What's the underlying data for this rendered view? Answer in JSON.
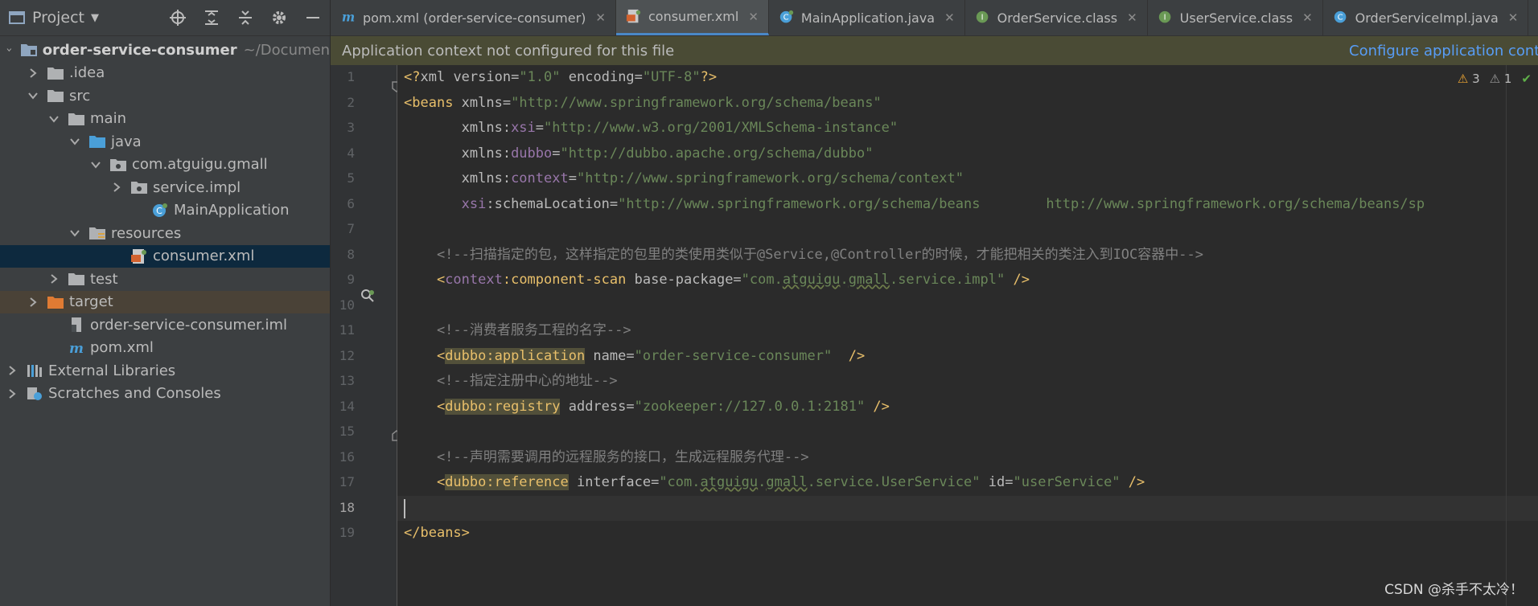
{
  "sidebar": {
    "title": "Project",
    "tree": [
      {
        "label": "order-service-consumer",
        "suffix": "~/Documen",
        "bold": true,
        "expanded": true,
        "depth": 0,
        "icon": "module-folder-icon"
      },
      {
        "label": ".idea",
        "expanded": false,
        "depth": 1,
        "icon": "folder-icon"
      },
      {
        "label": "src",
        "expanded": true,
        "depth": 1,
        "icon": "folder-icon"
      },
      {
        "label": "main",
        "expanded": true,
        "depth": 2,
        "icon": "folder-icon"
      },
      {
        "label": "java",
        "expanded": true,
        "depth": 3,
        "icon": "source-folder-icon"
      },
      {
        "label": "com.atguigu.gmall",
        "expanded": true,
        "depth": 4,
        "icon": "package-icon"
      },
      {
        "label": "service.impl",
        "expanded": false,
        "depth": 5,
        "icon": "package-icon"
      },
      {
        "label": "MainApplication",
        "depth": 6,
        "icon": "spring-class-icon"
      },
      {
        "label": "resources",
        "expanded": true,
        "depth": 3,
        "icon": "resources-folder-icon"
      },
      {
        "label": "consumer.xml",
        "depth": 5,
        "icon": "spring-xml-icon",
        "selected": true
      },
      {
        "label": "test",
        "expanded": false,
        "depth": 2,
        "icon": "folder-icon"
      },
      {
        "label": "target",
        "expanded": false,
        "depth": 1,
        "icon": "excluded-folder-icon",
        "excluded": true
      },
      {
        "label": "order-service-consumer.iml",
        "depth": 2,
        "icon": "iml-file-icon"
      },
      {
        "label": "pom.xml",
        "depth": 2,
        "icon": "maven-icon"
      },
      {
        "label": "External Libraries",
        "expanded": false,
        "depth": 0,
        "icon": "libraries-icon"
      },
      {
        "label": "Scratches and Consoles",
        "expanded": false,
        "depth": 0,
        "icon": "scratches-icon"
      }
    ]
  },
  "tabs": [
    {
      "label": "pom.xml (order-service-consumer)",
      "icon": "maven-icon",
      "active": false
    },
    {
      "label": "consumer.xml",
      "icon": "spring-xml-icon",
      "active": true
    },
    {
      "label": "MainApplication.java",
      "icon": "spring-class-icon",
      "active": false
    },
    {
      "label": "OrderService.class",
      "icon": "interface-icon",
      "active": false
    },
    {
      "label": "UserService.class",
      "icon": "interface-icon",
      "active": false
    },
    {
      "label": "OrderServiceImpl.java",
      "icon": "class-icon",
      "active": false
    }
  ],
  "notification": {
    "message": "Application context not configured for this file",
    "link": "Configure application cont"
  },
  "inspection": {
    "warnings": "3",
    "weak_warnings": "1"
  },
  "editor": {
    "current_line": 18,
    "lines": [
      {
        "n": "1",
        "tokens": [
          [
            "bracket",
            "<?"
          ],
          [
            "pi",
            "xml "
          ],
          [
            "attr",
            "version"
          ],
          [
            "pi",
            "="
          ],
          [
            "value",
            "\"1.0\""
          ],
          [
            "pi",
            " "
          ],
          [
            "attr",
            "encoding"
          ],
          [
            "pi",
            "="
          ],
          [
            "value",
            "\"UTF-8\""
          ],
          [
            "bracket",
            "?>"
          ]
        ]
      },
      {
        "n": "2",
        "tokens": [
          [
            "bracket",
            "<"
          ],
          [
            "tag",
            "beans "
          ],
          [
            "attr",
            "xmlns"
          ],
          [
            "attr",
            "="
          ],
          [
            "value",
            "\"http://www.springframework.org/schema/beans\""
          ]
        ]
      },
      {
        "n": "3",
        "tokens": [
          [
            "attr",
            "       xmlns:"
          ],
          [
            "ns",
            "xsi"
          ],
          [
            "attr",
            "="
          ],
          [
            "value",
            "\"http://www.w3.org/2001/XMLSchema-instance\""
          ]
        ]
      },
      {
        "n": "4",
        "tokens": [
          [
            "attr",
            "       xmlns:"
          ],
          [
            "ns",
            "dubbo"
          ],
          [
            "attr",
            "="
          ],
          [
            "value",
            "\"http://dubbo.apache.org/schema/dubbo\""
          ]
        ]
      },
      {
        "n": "5",
        "tokens": [
          [
            "attr",
            "       xmlns:"
          ],
          [
            "ns",
            "context"
          ],
          [
            "attr",
            "="
          ],
          [
            "value",
            "\"http://www.springframework.org/schema/context\""
          ]
        ]
      },
      {
        "n": "6",
        "tokens": [
          [
            "ns",
            "       xsi"
          ],
          [
            "attr",
            ":schemaLocation="
          ],
          [
            "value",
            "\"http://www.springframework.org/schema/beans        http://www.springframework.org/schema/beans/sp"
          ]
        ]
      },
      {
        "n": "7",
        "tokens": []
      },
      {
        "n": "8",
        "tokens": [
          [
            "comment",
            "    <!--扫描指定的包，这样指定的包里的类使用类似于@Service,@Controller的时候，才能把相关的类注入到IOC容器中-->"
          ]
        ]
      },
      {
        "n": "9",
        "tokens": [
          [
            "bracket",
            "    <"
          ],
          [
            "ns",
            "context"
          ],
          [
            "tag",
            ":component-scan "
          ],
          [
            "attr",
            "base-package="
          ],
          [
            "value",
            "\"com."
          ],
          [
            "valuewavy",
            "atguigu"
          ],
          [
            "value",
            "."
          ],
          [
            "valuewavy",
            "gmall"
          ],
          [
            "value",
            ".service.impl\""
          ],
          [
            "bracket",
            " />"
          ]
        ]
      },
      {
        "n": "10",
        "tokens": []
      },
      {
        "n": "11",
        "tokens": [
          [
            "comment",
            "    <!--消费者服务工程的名字-->"
          ]
        ]
      },
      {
        "n": "12",
        "tokens": [
          [
            "bracket",
            "    <"
          ],
          [
            "tagbox",
            "dubbo:application"
          ],
          [
            "attr",
            " name="
          ],
          [
            "value",
            "\"order-service-consumer\""
          ],
          [
            "bracket",
            "  />"
          ]
        ]
      },
      {
        "n": "13",
        "tokens": [
          [
            "comment",
            "    <!--指定注册中心的地址-->"
          ]
        ]
      },
      {
        "n": "14",
        "tokens": [
          [
            "bracket",
            "    <"
          ],
          [
            "tagbox",
            "dubbo:registry"
          ],
          [
            "attr",
            " address="
          ],
          [
            "value",
            "\"zookeeper://127.0.0.1:2181\""
          ],
          [
            "bracket",
            " />"
          ]
        ]
      },
      {
        "n": "15",
        "tokens": []
      },
      {
        "n": "16",
        "tokens": [
          [
            "comment",
            "    <!--声明需要调用的远程服务的接口，生成远程服务代理-->"
          ]
        ]
      },
      {
        "n": "17",
        "tokens": [
          [
            "bracket",
            "    <"
          ],
          [
            "tagbox",
            "dubbo:reference"
          ],
          [
            "attr",
            " interface="
          ],
          [
            "value",
            "\"com."
          ],
          [
            "valuewavy",
            "atguigu"
          ],
          [
            "value",
            "."
          ],
          [
            "valuewavy",
            "gmall"
          ],
          [
            "value",
            ".service.UserService\""
          ],
          [
            "attr",
            " id="
          ],
          [
            "value",
            "\"userService\""
          ],
          [
            "bracket",
            " />"
          ]
        ]
      },
      {
        "n": "18",
        "tokens": []
      },
      {
        "n": "19",
        "tokens": [
          [
            "bracket",
            "</"
          ],
          [
            "tag",
            "beans"
          ],
          [
            "bracket",
            ">"
          ]
        ]
      }
    ]
  },
  "watermark": "CSDN @杀手不太冷！",
  "colors": {
    "accent": "#4a88c7",
    "selection": "#0d293e",
    "link": "#589df6"
  }
}
